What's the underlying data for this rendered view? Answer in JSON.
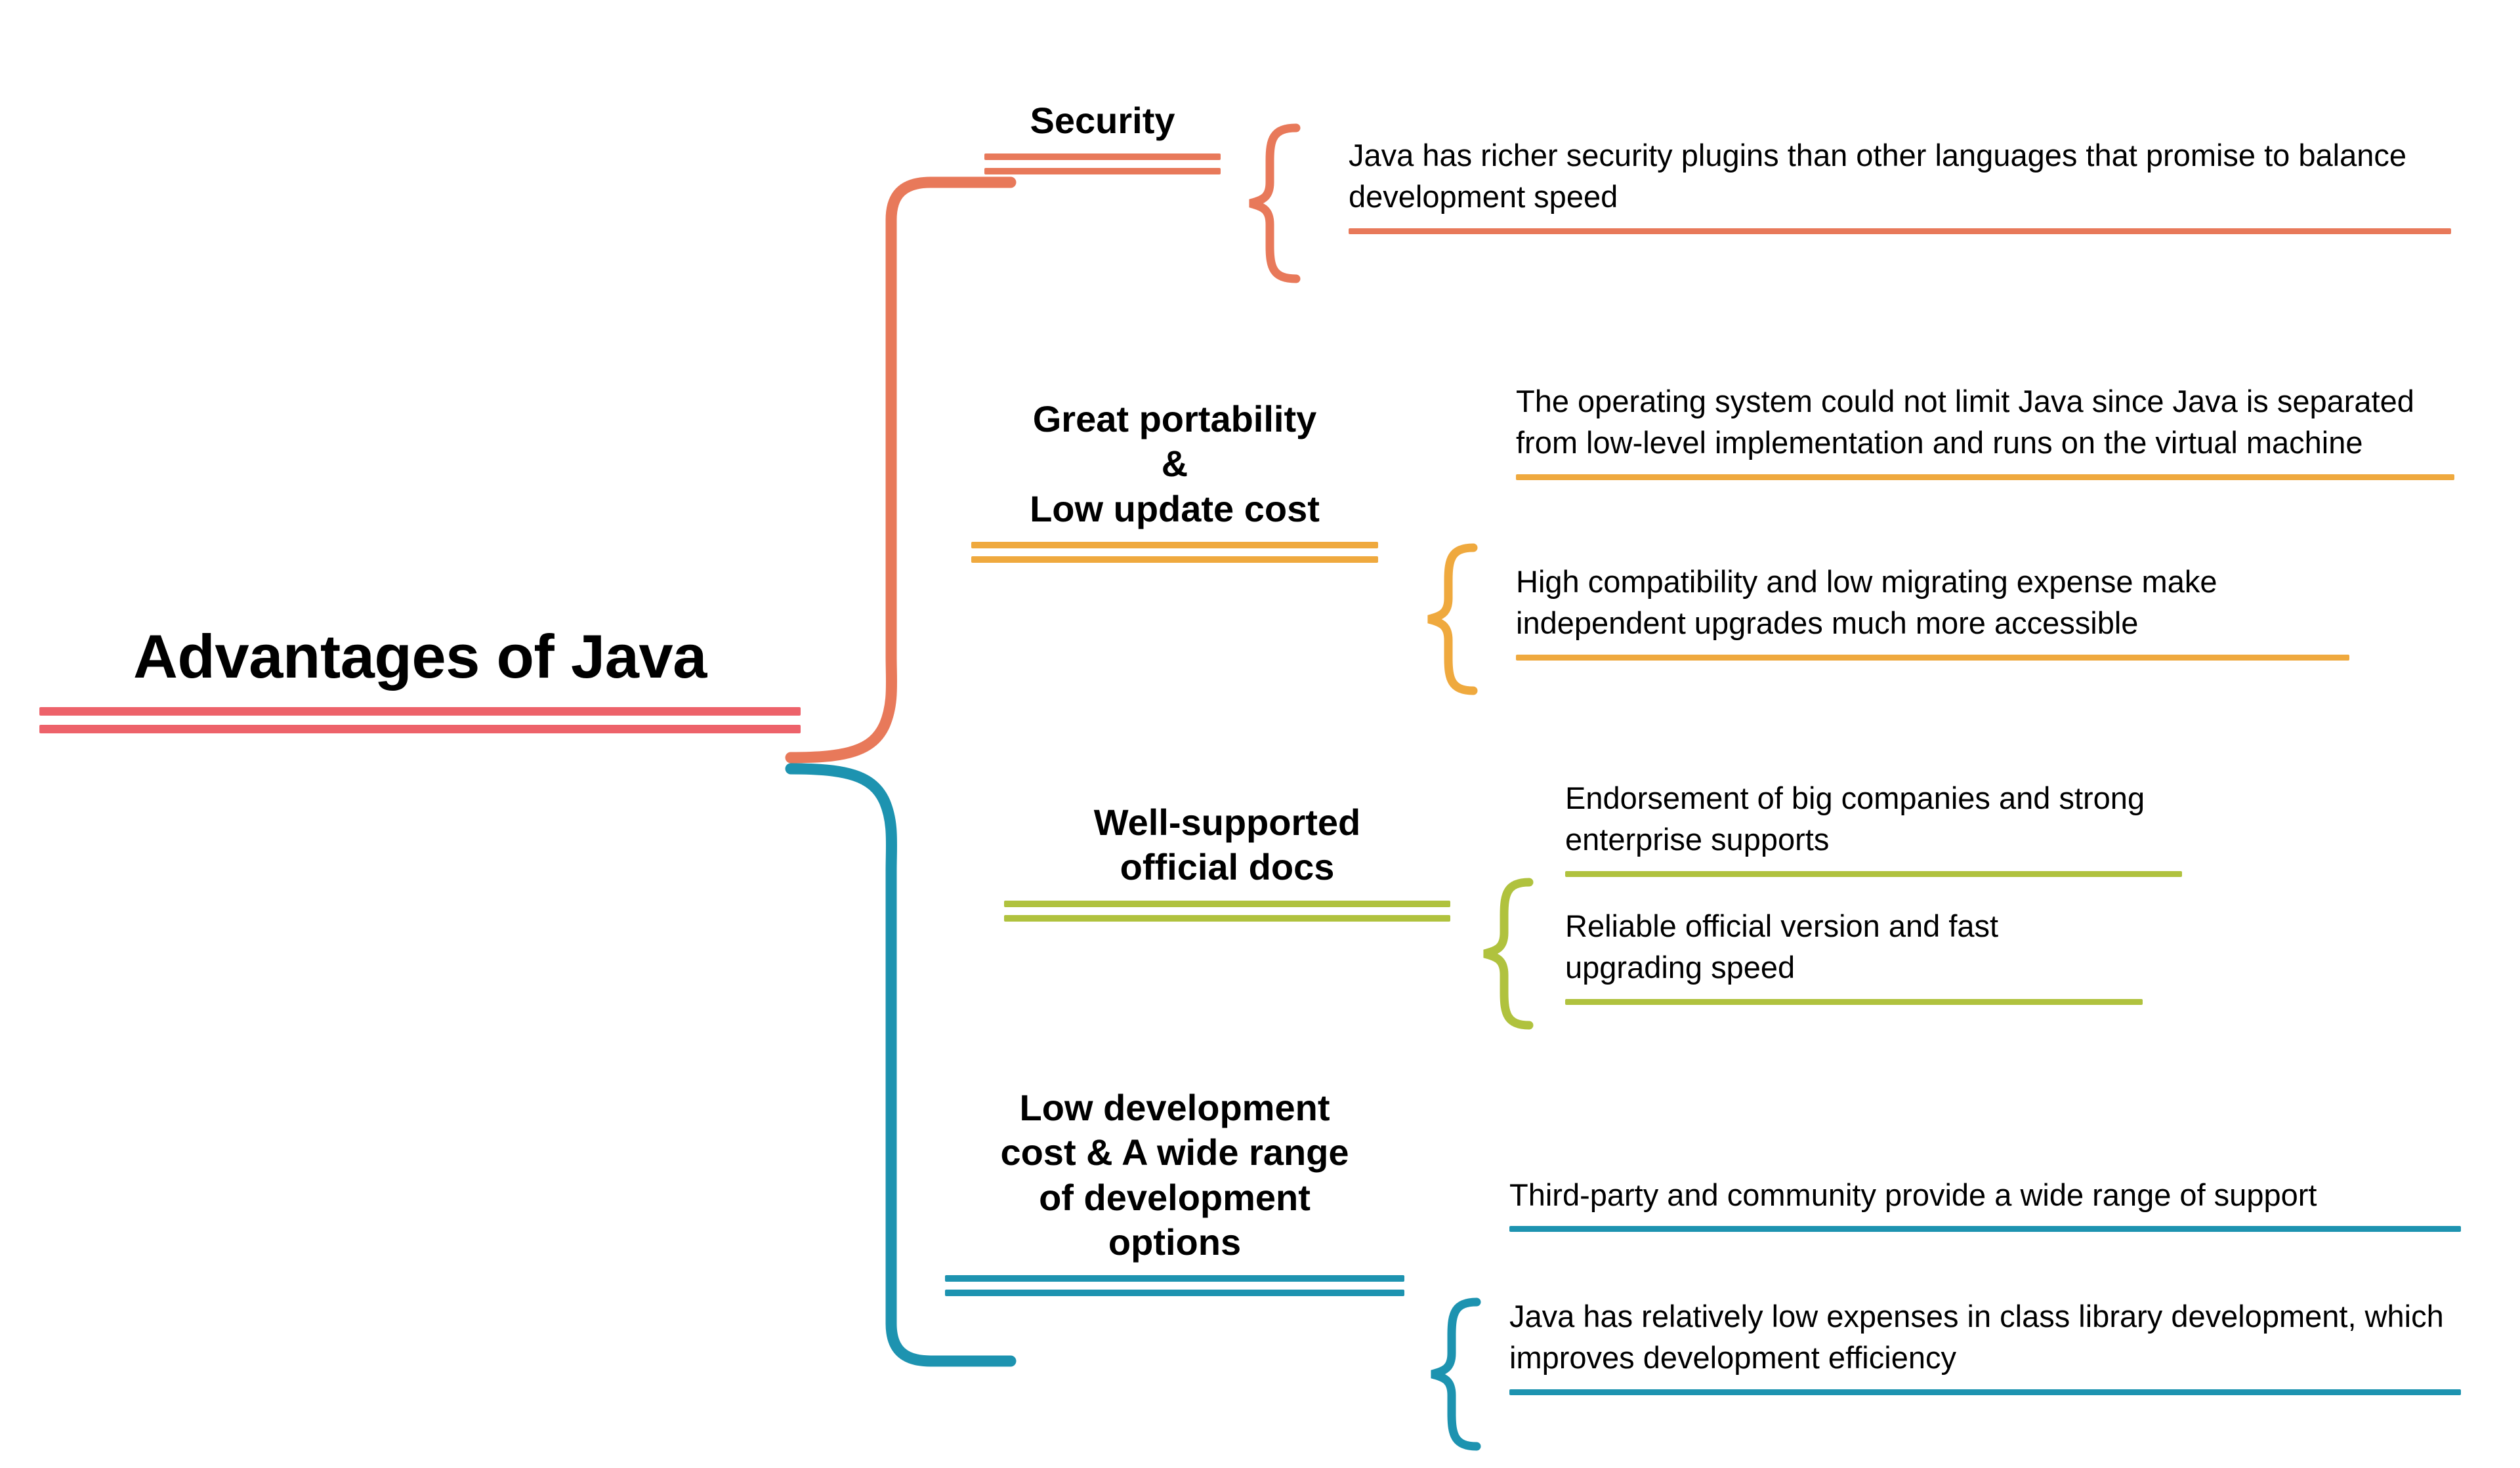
{
  "diagram": {
    "type": "mind-map",
    "title": "Advantages of Java",
    "root": {
      "label": "Advantages of Java",
      "accent": "#ED626A"
    },
    "branches": [
      {
        "id": "security",
        "label": "Security",
        "accent": "#E8795A",
        "details": [
          {
            "text": "Java has richer security plugins than other languages that promise to balance development speed",
            "has_top_rule": false,
            "has_bottom_rule": true
          }
        ]
      },
      {
        "id": "portability",
        "label": "Great portability\n&\nLow update cost",
        "accent": "#EFA93E",
        "details": [
          {
            "text": "The operating system could not limit Java since Java is separated from low-level implementation and runs on the virtual machine",
            "has_top_rule": false,
            "has_bottom_rule": true
          },
          {
            "text": "High compatibility and low migrating expense make independent upgrades much more accessible",
            "has_top_rule": false,
            "has_bottom_rule": true
          }
        ]
      },
      {
        "id": "official-docs",
        "label": "Well-supported\nofficial docs",
        "accent": "#B0C23E",
        "details": [
          {
            "text": "Endorsement of big companies and strong enterprise supports",
            "has_top_rule": false,
            "has_bottom_rule": true
          },
          {
            "text": "Reliable official version and fast upgrading speed",
            "has_top_rule": false,
            "has_bottom_rule": true
          }
        ]
      },
      {
        "id": "low-cost",
        "label": "Low development\ncost & A wide range\nof development\noptions",
        "accent": "#1D93B0",
        "details": [
          {
            "text": "Third-party and community provide a wide range of support",
            "has_top_rule": false,
            "has_bottom_rule": true
          },
          {
            "text": "Java has relatively low expenses in class library development, which improves development efficiency",
            "has_top_rule": false,
            "has_bottom_rule": true
          }
        ]
      }
    ],
    "colors": {
      "root_red": "#ED626A",
      "orange": "#E8795A",
      "amber": "#EFA93E",
      "green": "#B0C23E",
      "teal": "#1D93B0",
      "background": "#FFFFFF",
      "text": "#000000"
    }
  },
  "headings": {
    "security": "Security",
    "portability": "Great portability\n&\nLow update cost",
    "docs": "Well-supported\nofficial docs",
    "lowcost": "Low development\ncost & A wide range\nof development\noptions"
  },
  "details": {
    "security_1": "Java has richer security plugins than other languages that promise to balance development speed",
    "portability_1": "The operating system could not limit Java since Java is separated from low-level implementation and runs on the virtual machine",
    "portability_2": "High compatibility and low migrating expense make independent upgrades much more accessible",
    "docs_1": "Endorsement of big companies and strong enterprise supports",
    "docs_2": "Reliable official version and fast upgrading speed",
    "lowcost_1": "Third-party and community provide a wide range of support",
    "lowcost_2": "Java has relatively low expenses in class library development, which improves development efficiency"
  }
}
